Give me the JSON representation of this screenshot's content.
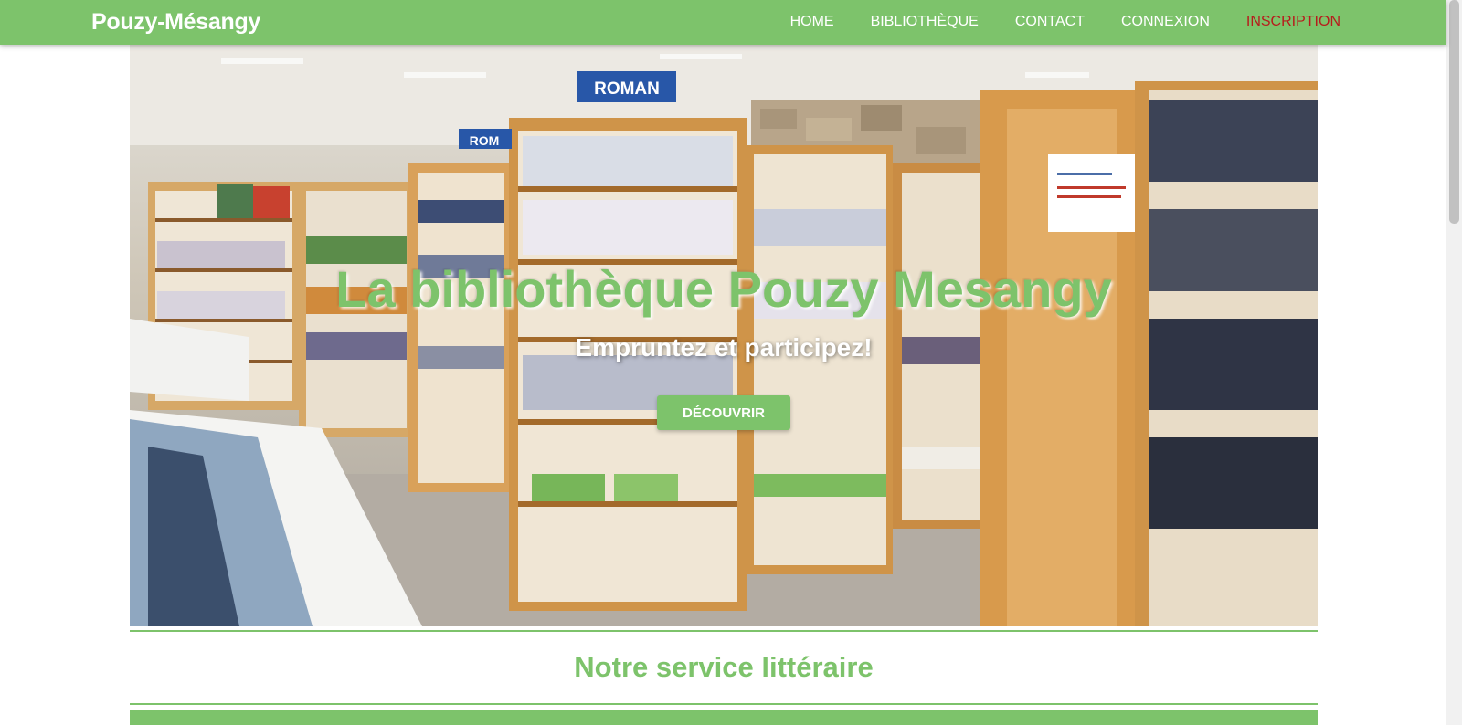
{
  "navbar": {
    "brand": "Pouzy-Mésangy",
    "items": [
      {
        "label": "HOME",
        "active": false
      },
      {
        "label": "BIBLIOTHÈQUE",
        "active": false
      },
      {
        "label": "CONTACT",
        "active": false
      },
      {
        "label": "CONNEXION",
        "active": false
      },
      {
        "label": "INSCRIPTION",
        "active": true
      }
    ]
  },
  "hero": {
    "title": "La bibliothèque Pouzy Mesangy",
    "subtitle": "Empruntez et participez!",
    "button_label": "DÉCOUVRIR",
    "signs": [
      "ROMAN",
      "ROM"
    ]
  },
  "section": {
    "title": "Notre service littéraire"
  },
  "colors": {
    "primary": "#7dc36b",
    "active_nav": "#b71c1c",
    "white": "#ffffff"
  }
}
